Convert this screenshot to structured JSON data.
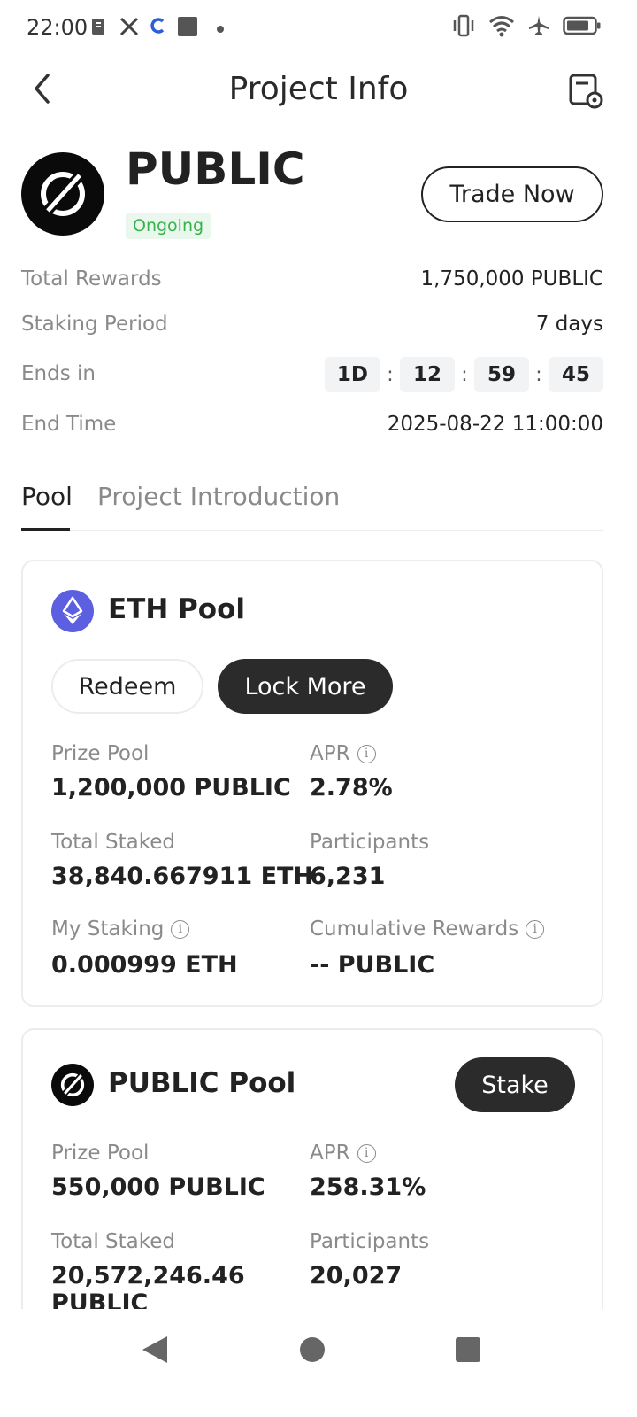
{
  "status_bar": {
    "time": "22:00",
    "left_icons": [
      "file-icon",
      "x-logo-icon",
      "app-icon",
      "square-app-icon",
      "dot-icon"
    ],
    "right_icons": [
      "vibrate-icon",
      "wifi-icon",
      "airplane-icon",
      "battery-icon"
    ]
  },
  "header": {
    "title": "Project Info",
    "back_icon": "chevron-left-icon",
    "settings_icon": "document-settings-icon"
  },
  "project": {
    "name": "PUBLIC",
    "status": "Ongoing",
    "trade_label": "Trade Now",
    "colors": {
      "status_bg": "#e9f7ec",
      "status_text": "#37b24d"
    }
  },
  "info": {
    "total_rewards_label": "Total Rewards",
    "total_rewards_value": "1,750,000 PUBLIC",
    "staking_period_label": "Staking Period",
    "staking_period_value": "7 days",
    "ends_in_label": "Ends in",
    "countdown": {
      "days": "1D",
      "hours": "12",
      "minutes": "59",
      "seconds": "45",
      "separator": ":"
    },
    "end_time_label": "End Time",
    "end_time_value": "2025-08-22 11:00:00"
  },
  "tabs": [
    {
      "label": "Pool",
      "active": true
    },
    {
      "label": "Project Introduction",
      "active": false
    }
  ],
  "eth_pool": {
    "name": "ETH Pool",
    "icon_color": "#5b5fe0",
    "redeem_label": "Redeem",
    "lock_more_label": "Lock More",
    "prize_pool_label": "Prize Pool",
    "prize_pool_value": "1,200,000 PUBLIC",
    "apr_label": "APR",
    "apr_value": "2.78%",
    "total_staked_label": "Total Staked",
    "total_staked_value": "38,840.667911 ETH",
    "participants_label": "Participants",
    "participants_value": "6,231",
    "my_staking_label": "My Staking",
    "my_staking_value": "0.000999 ETH",
    "cumulative_rewards_label": "Cumulative Rewards",
    "cumulative_rewards_value": "-- PUBLIC"
  },
  "public_pool": {
    "name": "PUBLIC Pool",
    "stake_label": "Stake",
    "prize_pool_label": "Prize Pool",
    "prize_pool_value": "550,000 PUBLIC",
    "apr_label": "APR",
    "apr_value": "258.31%",
    "total_staked_label": "Total Staked",
    "total_staked_value_line1": "20,572,246.46",
    "total_staked_value_line2": "PUBLIC",
    "participants_label": "Participants",
    "participants_value": "20,027"
  },
  "nav_bar": {
    "back_icon": "triangle-back-icon",
    "home_icon": "circle-home-icon",
    "recents_icon": "square-recents-icon"
  }
}
